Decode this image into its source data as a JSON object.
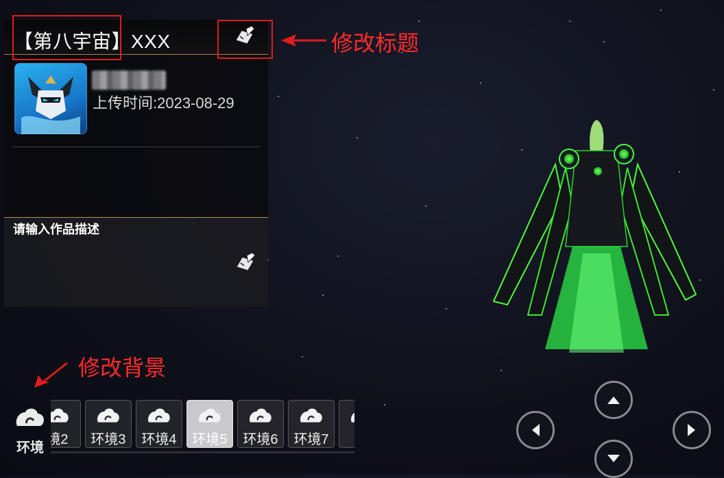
{
  "header": {
    "title": "【第八宇宙】XXX"
  },
  "profile": {
    "upload_time": "上传时间:2023-08-29"
  },
  "description": {
    "placeholder": "请输入作品描述"
  },
  "annotations": {
    "edit_title": "修改标题",
    "edit_background": "修改背景"
  },
  "environment": {
    "main_label": "环境",
    "items": [
      {
        "label": "境2",
        "selected": false
      },
      {
        "label": "环境3",
        "selected": false
      },
      {
        "label": "环境4",
        "selected": false
      },
      {
        "label": "环境5",
        "selected": true
      },
      {
        "label": "环境6",
        "selected": false
      },
      {
        "label": "环境7",
        "selected": false
      },
      {
        "label": "环",
        "selected": false
      }
    ]
  },
  "icons": {
    "edit": "edit-pen-icon",
    "environment": "cloud-swirl-icon",
    "up": "chevron-up-icon",
    "down": "chevron-down-icon",
    "left": "chevron-left-icon",
    "right": "chevron-right-icon"
  },
  "colors": {
    "annotation_red": "#e11d1d",
    "panel_gold_line": "#b49348",
    "figure_glow": "#39ff3a"
  }
}
